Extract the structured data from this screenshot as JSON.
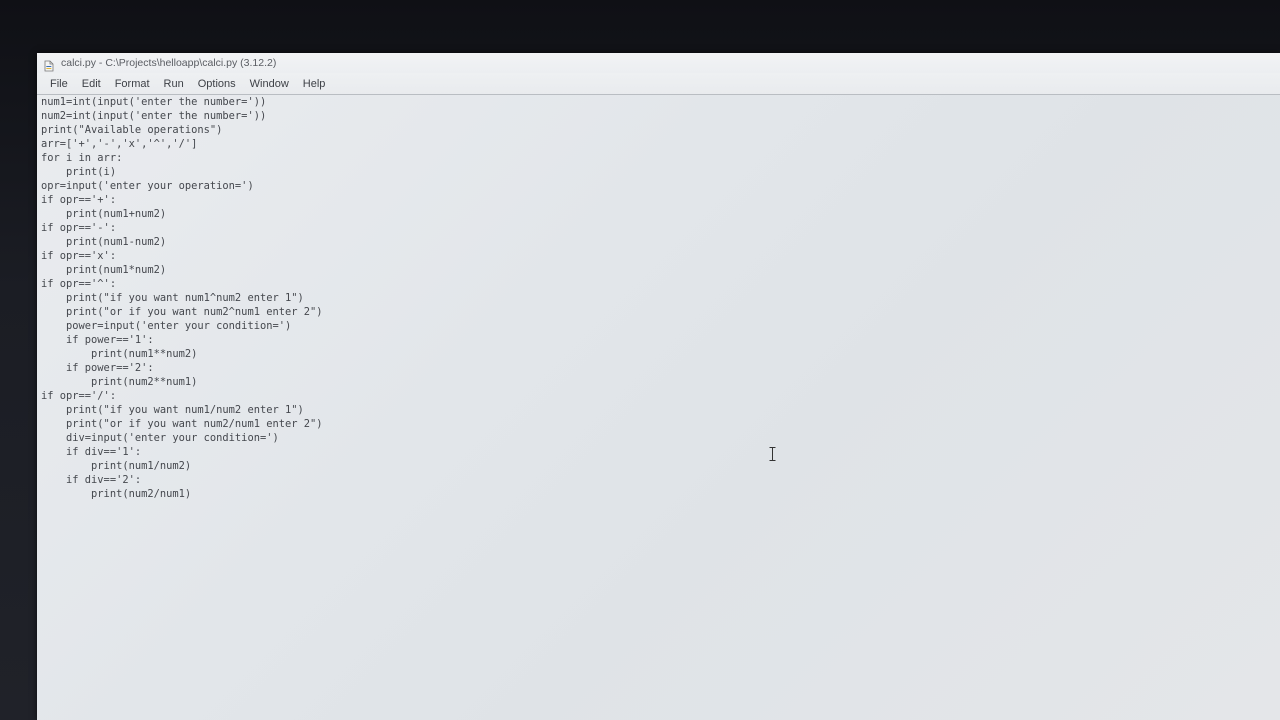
{
  "window": {
    "title": "calci.py - C:\\Projects\\helloapp\\calci.py (3.12.2)",
    "icon": "python-idle-icon"
  },
  "menu": {
    "items": [
      {
        "label": "File"
      },
      {
        "label": "Edit"
      },
      {
        "label": "Format"
      },
      {
        "label": "Run"
      },
      {
        "label": "Options"
      },
      {
        "label": "Window"
      },
      {
        "label": "Help"
      }
    ]
  },
  "editor": {
    "lines": [
      "num1=int(input('enter the number='))",
      "num2=int(input('enter the number='))",
      "print(\"Available operations\")",
      "arr=['+','-','x','^','/']",
      "for i in arr:",
      "    print(i)",
      "opr=input('enter your operation=')",
      "if opr=='+':",
      "    print(num1+num2)",
      "if opr=='-':",
      "    print(num1-num2)",
      "if opr=='x':",
      "    print(num1*num2)",
      "if opr=='^':",
      "    print(\"if you want num1^num2 enter 1\")",
      "    print(\"or if you want num2^num1 enter 2\")",
      "    power=input('enter your condition=')",
      "    if power=='1':",
      "        print(num1**num2)",
      "    if power=='2':",
      "        print(num2**num1)",
      "if opr=='/':",
      "    print(\"if you want num1/num2 enter 1\")",
      "    print(\"or if you want num2/num1 enter 2\")",
      "    div=input('enter your condition=')",
      "    if div=='1':",
      "        print(num1/num2)",
      "    if div=='2':",
      "        print(num2/num1)"
    ]
  }
}
